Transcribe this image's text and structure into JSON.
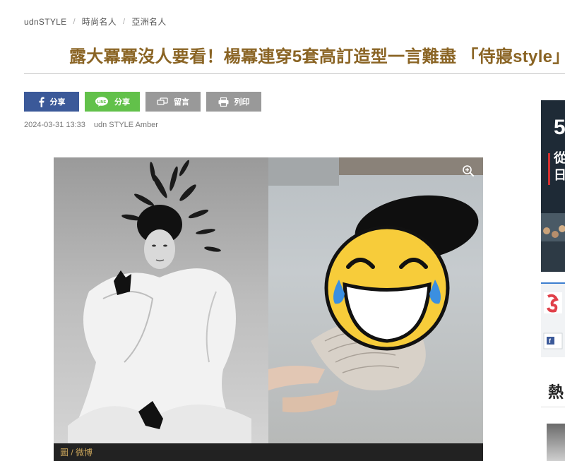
{
  "breadcrumb": {
    "items": [
      "udnSTYLE",
      "時尚名人",
      "亞洲名人"
    ],
    "separator": "/"
  },
  "article": {
    "title": "露大冪冪沒人要看！楊冪連穿5套高訂造型一言難盡 「侍寢style」",
    "published": "2024-03-31 13:33",
    "author": "udn STYLE Amber",
    "image_caption": "圖 / 微博"
  },
  "share": {
    "facebook_label": "分享",
    "line_label": "分享",
    "comment_label": "留言",
    "print_label": "列印",
    "line_badge": "LINE"
  },
  "sidebar": {
    "ad_top_text_1": "5",
    "ad_top_text_2": "從",
    "ad_top_text_3": "日",
    "hot_heading": "熱"
  },
  "colors": {
    "title": "#8a6424",
    "facebook": "#3b5999",
    "line": "#62c14a",
    "gray_button": "#999999",
    "caption": "#c9a45a"
  },
  "icons": {
    "facebook": "facebook-icon",
    "line": "line-icon",
    "comment": "comment-icon",
    "print": "print-icon",
    "zoom": "zoom-in-icon",
    "emoji": "laughing-crying-emoji"
  }
}
